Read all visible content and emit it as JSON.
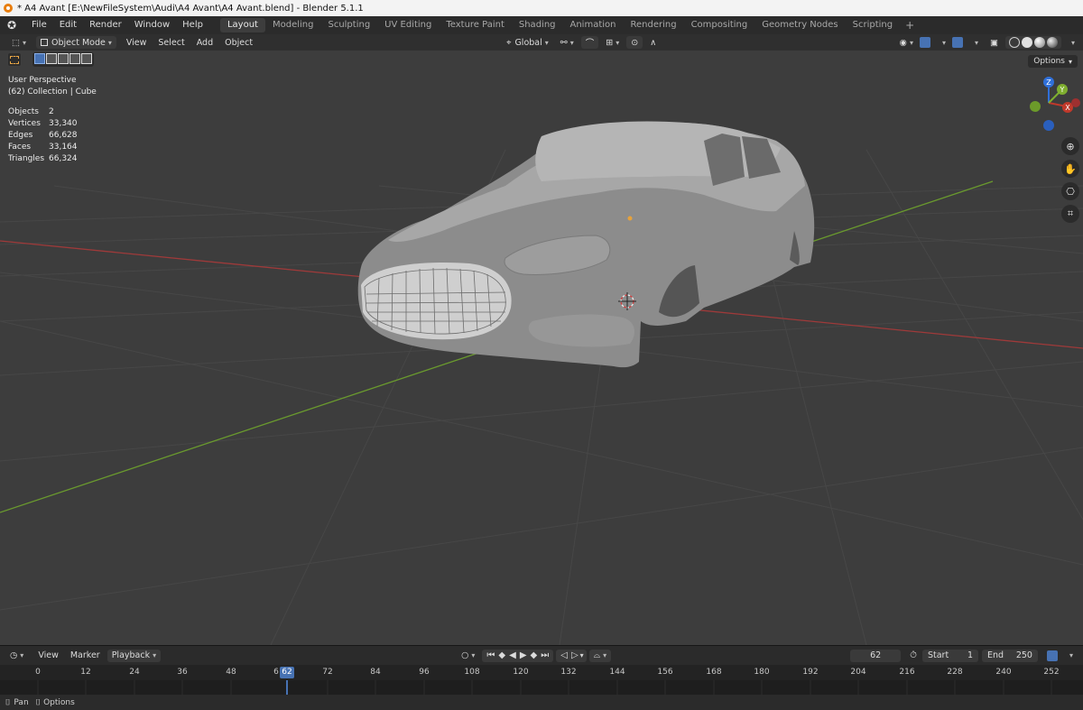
{
  "window": {
    "title": "* A4 Avant [E:\\NewFileSystem\\Audi\\A4 Avant\\A4 Avant.blend] - Blender 5.1.1"
  },
  "menu": [
    "File",
    "Edit",
    "Render",
    "Window",
    "Help"
  ],
  "workspaces": [
    "Layout",
    "Modeling",
    "Sculpting",
    "UV Editing",
    "Texture Paint",
    "Shading",
    "Animation",
    "Rendering",
    "Compositing",
    "Geometry Nodes",
    "Scripting"
  ],
  "active_workspace": "Layout",
  "viewport_header": {
    "mode": "Object Mode",
    "menus": [
      "View",
      "Select",
      "Add",
      "Object"
    ],
    "orientation": "Global"
  },
  "viewport": {
    "view_name": "User Perspective",
    "collection_info": "(62) Collection | Cube",
    "stats": [
      {
        "label": "Objects",
        "value": "2"
      },
      {
        "label": "Vertices",
        "value": "33,340"
      },
      {
        "label": "Edges",
        "value": "66,628"
      },
      {
        "label": "Faces",
        "value": "33,164"
      },
      {
        "label": "Triangles",
        "value": "66,324"
      }
    ],
    "options_label": "Options",
    "gizmo_axes": {
      "x": "X",
      "y": "Y",
      "z": "Z"
    }
  },
  "timeline": {
    "menus": [
      "View",
      "Marker"
    ],
    "playback_label": "Playback",
    "current_frame": "62",
    "start_label": "Start",
    "start_value": "1",
    "end_label": "End",
    "end_value": "250",
    "ticks": [
      "0",
      "12",
      "24",
      "36",
      "48",
      "6",
      "72",
      "84",
      "96",
      "108",
      "120",
      "132",
      "144",
      "156",
      "168",
      "180",
      "192",
      "204",
      "216",
      "228",
      "240",
      "252"
    ],
    "playhead_label": "62"
  },
  "status_bar": {
    "pan": "Pan",
    "options": "Options"
  },
  "colors": {
    "accent": "#4772b3",
    "x_axis": "#c0392b",
    "y_axis": "#7fae2f",
    "z_axis": "#2f6fd8"
  }
}
